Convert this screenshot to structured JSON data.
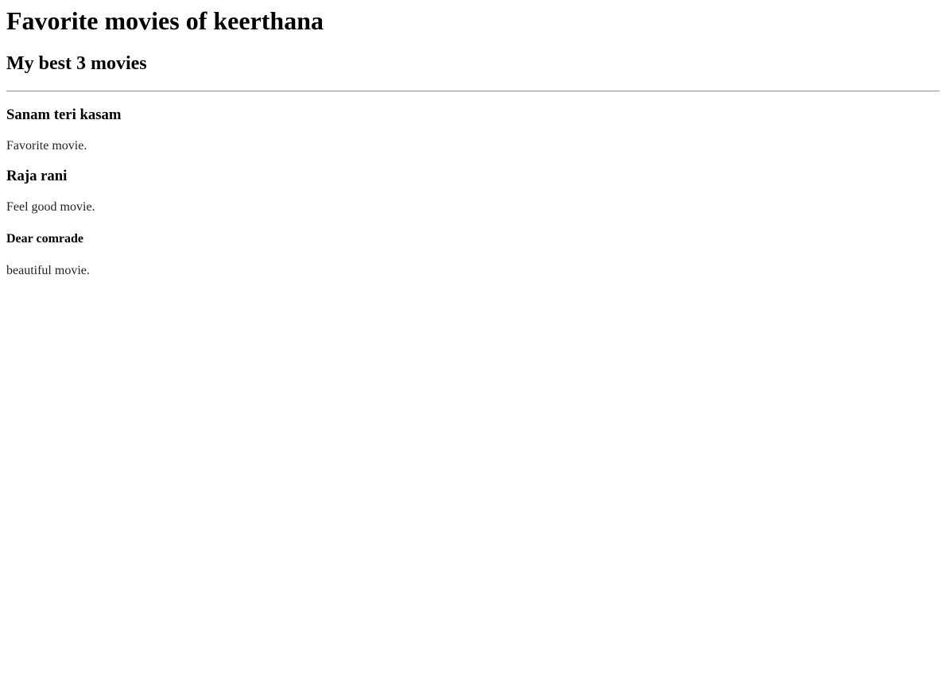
{
  "title": "Favorite movies of keerthana",
  "subtitle": "My best 3 movies",
  "movies": [
    {
      "name": "Sanam teri kasam",
      "desc": "Favorite movie."
    },
    {
      "name": "Raja rani",
      "desc": "Feel good movie."
    },
    {
      "name": "Dear comrade",
      "desc": "beautiful movie."
    }
  ]
}
